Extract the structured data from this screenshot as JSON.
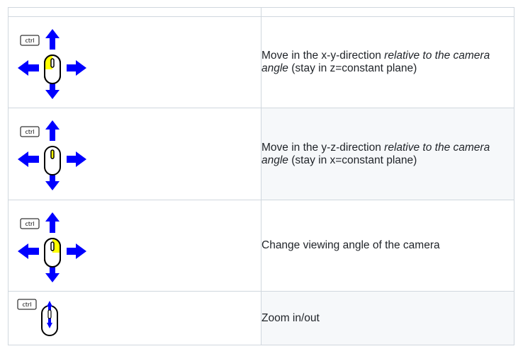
{
  "rows": [
    {
      "key_label": "ctrl",
      "icon": "mouse-left-button-drag-xy",
      "text_before": "Move in the x-y-direction ",
      "text_italic": "relative to the camera angle",
      "text_after": " (stay in z=constant plane)"
    },
    {
      "key_label": "ctrl",
      "icon": "mouse-wheel-drag-yz",
      "text_before": "Move in the y-z-direction ",
      "text_italic": "relative to the camera angle",
      "text_after": " (stay in x=constant plane)"
    },
    {
      "key_label": "ctrl",
      "icon": "mouse-right-button-drag",
      "text_before": "Change viewing angle of the camera",
      "text_italic": "",
      "text_after": ""
    },
    {
      "key_label": "ctrl",
      "icon": "mouse-wheel-scroll",
      "text_before": "Zoom in/out",
      "text_italic": "",
      "text_after": ""
    }
  ],
  "colors": {
    "arrow": "#0000ff",
    "highlight": "#ffff00",
    "border": "#d0d7de",
    "alt_row": "#f6f8fa"
  }
}
